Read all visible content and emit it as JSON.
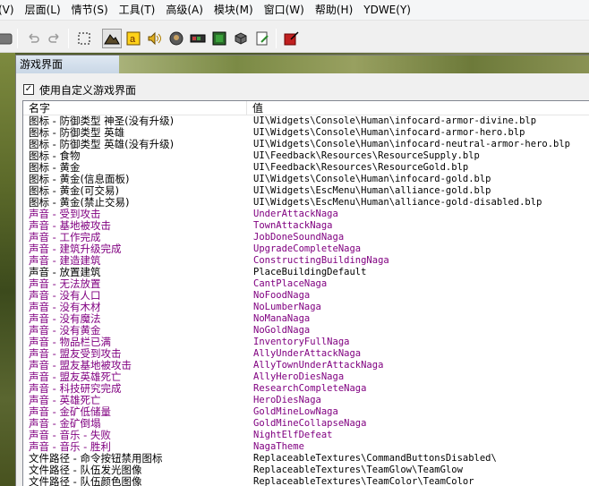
{
  "menubar": {
    "items": [
      "(V)",
      "层面(L)",
      "情节(S)",
      "工具(T)",
      "高级(A)",
      "模块(M)",
      "窗口(W)",
      "帮助(H)",
      "YDWE(Y)"
    ]
  },
  "toolbar": {
    "icons": [
      "tool-icon",
      "undo-icon",
      "redo-icon",
      "select-icon",
      "terrain-icon",
      "doodad-icon",
      "sound-icon",
      "unit-icon",
      "item-icon",
      "region-icon",
      "camera-icon",
      "object-editor-icon",
      "import-icon"
    ]
  },
  "dialog": {
    "title": "游戏界面",
    "use_custom_label": "使用自定义游戏界面",
    "use_custom_checked": true,
    "columns": {
      "name": "名字",
      "value": "值"
    },
    "rows": [
      {
        "name": "图标 - 防御类型 神圣(没有升级)",
        "value": "UI\\Widgets\\Console\\Human\\infocard-armor-divine.blp",
        "modified": false
      },
      {
        "name": "图标 - 防御类型 英雄",
        "value": "UI\\Widgets\\Console\\Human\\infocard-armor-hero.blp",
        "modified": false
      },
      {
        "name": "图标 - 防御类型 英雄(没有升级)",
        "value": "UI\\Widgets\\Console\\Human\\infocard-neutral-armor-hero.blp",
        "modified": false
      },
      {
        "name": "图标 - 食物",
        "value": "UI\\Feedback\\Resources\\ResourceSupply.blp",
        "modified": false
      },
      {
        "name": "图标 - 黄金",
        "value": "UI\\Feedback\\Resources\\ResourceGold.blp",
        "modified": false
      },
      {
        "name": "图标 - 黄金(信息面板)",
        "value": "UI\\Widgets\\Console\\Human\\infocard-gold.blp",
        "modified": false
      },
      {
        "name": "图标 - 黄金(可交易)",
        "value": "UI\\Widgets\\EscMenu\\Human\\alliance-gold.blp",
        "modified": false
      },
      {
        "name": "图标 - 黄金(禁止交易)",
        "value": "UI\\Widgets\\EscMenu\\Human\\alliance-gold-disabled.blp",
        "modified": false
      },
      {
        "name": "声音 - 受到攻击",
        "value": "UnderAttackNaga",
        "modified": true
      },
      {
        "name": "声音 - 基地被攻击",
        "value": "TownAttackNaga",
        "modified": true
      },
      {
        "name": "声音 - 工作完成",
        "value": "JobDoneSoundNaga",
        "modified": true
      },
      {
        "name": "声音 - 建筑升级完成",
        "value": "UpgradeCompleteNaga",
        "modified": true
      },
      {
        "name": "声音 - 建造建筑",
        "value": "ConstructingBuildingNaga",
        "modified": true
      },
      {
        "name": "声音 - 放置建筑",
        "value": "PlaceBuildingDefault",
        "modified": false
      },
      {
        "name": "声音 - 无法放置",
        "value": "CantPlaceNaga",
        "modified": true
      },
      {
        "name": "声音 - 没有人口",
        "value": "NoFoodNaga",
        "modified": true
      },
      {
        "name": "声音 - 没有木材",
        "value": "NoLumberNaga",
        "modified": true
      },
      {
        "name": "声音 - 没有魔法",
        "value": "NoManaNaga",
        "modified": true
      },
      {
        "name": "声音 - 没有黄金",
        "value": "NoGoldNaga",
        "modified": true
      },
      {
        "name": "声音 - 物品栏已满",
        "value": "InventoryFullNaga",
        "modified": true
      },
      {
        "name": "声音 - 盟友受到攻击",
        "value": "AllyUnderAttackNaga",
        "modified": true
      },
      {
        "name": "声音 - 盟友基地被攻击",
        "value": "AllyTownUnderAttackNaga",
        "modified": true
      },
      {
        "name": "声音 - 盟友英雄死亡",
        "value": "AllyHeroDiesNaga",
        "modified": true
      },
      {
        "name": "声音 - 科技研究完成",
        "value": "ResearchCompleteNaga",
        "modified": true
      },
      {
        "name": "声音 - 英雄死亡",
        "value": "HeroDiesNaga",
        "modified": true
      },
      {
        "name": "声音 - 金矿低储量",
        "value": "GoldMineLowNaga",
        "modified": true
      },
      {
        "name": "声音 - 金矿倒塌",
        "value": "GoldMineCollapseNaga",
        "modified": true
      },
      {
        "name": "声音 - 音乐 - 失败",
        "value": "NightElfDefeat",
        "modified": true
      },
      {
        "name": "声音 - 音乐 - 胜利",
        "value": "NagaTheme",
        "modified": true
      },
      {
        "name": "文件路径 - 命令按钮禁用图标",
        "value": "ReplaceableTextures\\CommandButtonsDisabled\\",
        "modified": false
      },
      {
        "name": "文件路径 - 队伍发光图像",
        "value": "ReplaceableTextures\\TeamGlow\\TeamGlow",
        "modified": false
      },
      {
        "name": "文件路径 - 队伍颜色图像",
        "value": "ReplaceableTextures\\TeamColor\\TeamColor",
        "modified": false
      }
    ]
  }
}
